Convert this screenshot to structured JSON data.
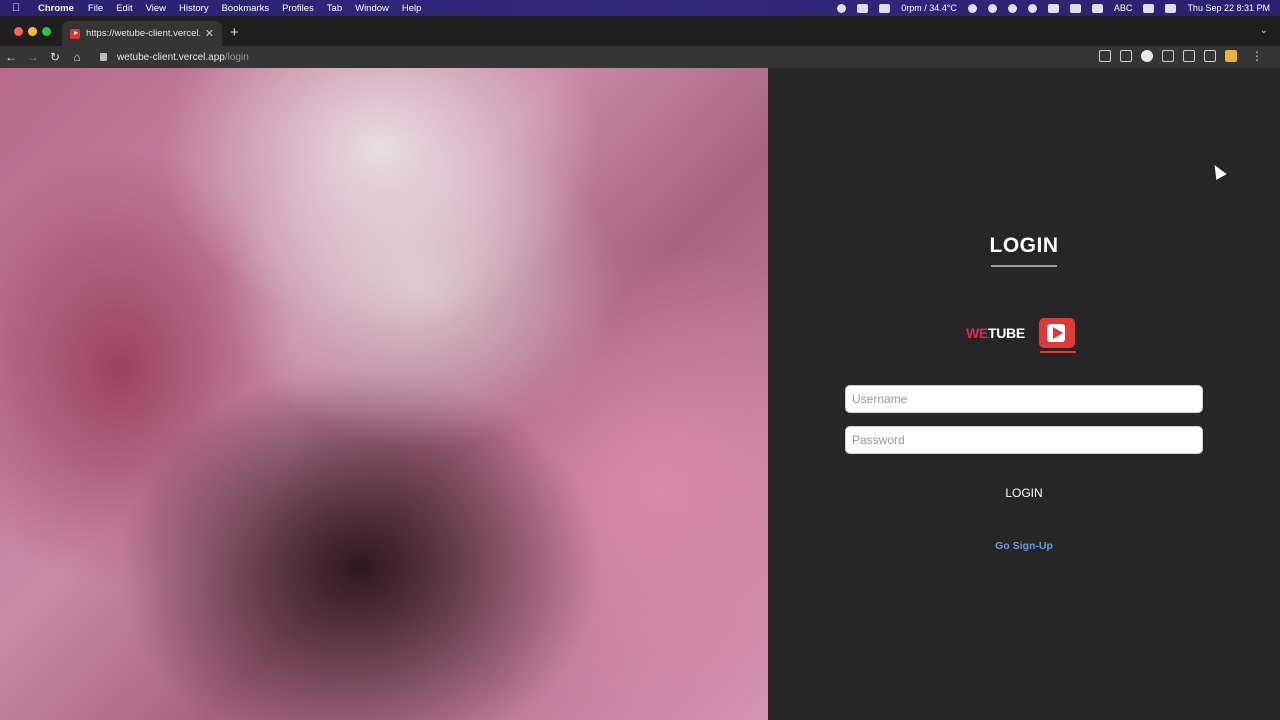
{
  "menubar": {
    "app": "Chrome",
    "menus": [
      "File",
      "Edit",
      "View",
      "History",
      "Bookmarks",
      "Profiles",
      "Tab",
      "Window",
      "Help"
    ],
    "status_fan": "0rpm / 34.4°C",
    "input_source": "ABC",
    "datetime": "Thu Sep 22  8:31 PM"
  },
  "browser": {
    "tab_title": "https://wetube-client.vercel.ap",
    "url_host": "wetube-client.vercel.app",
    "url_path": "/login"
  },
  "login": {
    "title": "LOGIN",
    "brand_we": "WE",
    "brand_tube": "TUBE",
    "username_placeholder": "Username",
    "password_placeholder": "Password",
    "submit_label": "LOGIN",
    "signup_link": "Go Sign-Up"
  },
  "colors": {
    "brand_red": "#e23838",
    "link_blue": "#6e9be6",
    "panel_bg": "#262626"
  }
}
